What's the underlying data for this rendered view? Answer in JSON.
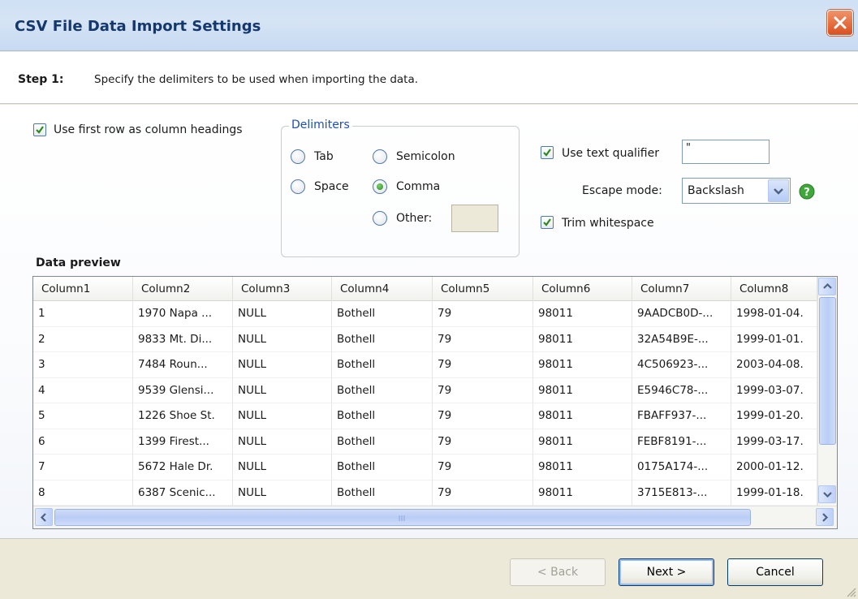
{
  "window": {
    "title": "CSV File Data Import Settings"
  },
  "step": {
    "label": "Step 1:",
    "text": "Specify the delimiters to be used when importing the data."
  },
  "options": {
    "first_row_headings": {
      "label": "Use first row as column headings",
      "checked": true
    },
    "delimiters": {
      "legend": "Delimiters",
      "tab": "Tab",
      "semicolon": "Semicolon",
      "space": "Space",
      "comma": "Comma",
      "other": "Other:",
      "other_value": "",
      "selected": "Comma"
    },
    "text_qualifier": {
      "label": "Use text qualifier",
      "checked": true,
      "value": "\""
    },
    "escape_mode": {
      "label": "Escape mode:",
      "value": "Backslash"
    },
    "trim_whitespace": {
      "label": "Trim whitespace",
      "checked": true
    }
  },
  "preview": {
    "title": "Data preview",
    "columns": [
      "Column1",
      "Column2",
      "Column3",
      "Column4",
      "Column5",
      "Column6",
      "Column7",
      "Column8"
    ],
    "rows": [
      [
        "1",
        "1970 Napa ...",
        "NULL",
        "Bothell",
        "79",
        "98011",
        "9AADCB0D-...",
        "1998-01-04."
      ],
      [
        "2",
        "9833 Mt. Di...",
        "NULL",
        "Bothell",
        "79",
        "98011",
        "32A54B9E-...",
        "1999-01-01."
      ],
      [
        "3",
        "7484 Roun...",
        "NULL",
        "Bothell",
        "79",
        "98011",
        "4C506923-...",
        "2003-04-08."
      ],
      [
        "4",
        "9539 Glensi...",
        "NULL",
        "Bothell",
        "79",
        "98011",
        "E5946C78-...",
        "1999-03-07."
      ],
      [
        "5",
        "1226 Shoe St.",
        "NULL",
        "Bothell",
        "79",
        "98011",
        "FBAFF937-...",
        "1999-01-20."
      ],
      [
        "6",
        "1399 Firest...",
        "NULL",
        "Bothell",
        "79",
        "98011",
        "FEBF8191-...",
        "1999-03-17."
      ],
      [
        "7",
        "5672 Hale Dr.",
        "NULL",
        "Bothell",
        "79",
        "98011",
        "0175A174-...",
        "2000-01-12."
      ],
      [
        "8",
        "6387 Scenic...",
        "NULL",
        "Bothell",
        "79",
        "98011",
        "3715E813-...",
        "1999-01-18."
      ]
    ]
  },
  "buttons": {
    "back": "< Back",
    "next": "Next >",
    "cancel": "Cancel"
  },
  "colors": {
    "title_text": "#14386e",
    "legend_text": "#1b4fb0",
    "check_green": "#2e8a20"
  }
}
